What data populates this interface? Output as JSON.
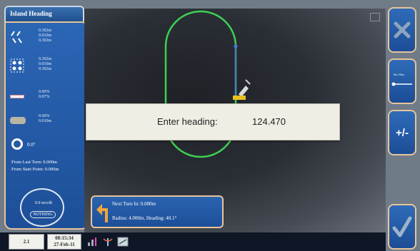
{
  "title": "Island Heading",
  "stats": [
    {
      "icon": "diagonal-lanes-icon",
      "values": [
        "0.302m",
        "0.010m",
        "0.302m"
      ]
    },
    {
      "icon": "dotted-square-icon",
      "values": [
        "0.302m",
        "0.010m",
        "0.302m"
      ]
    },
    {
      "icon": "lane-line-icon",
      "values": [
        "0.00%",
        "0.07%"
      ]
    },
    {
      "icon": "implement-icon",
      "values": [
        "0.00%",
        "0.010m"
      ]
    }
  ],
  "angle": "0.0°",
  "info": {
    "from_last_turn": "From Last Turn: 0.000m",
    "from_start_point": "From Start Point: 0.000m"
  },
  "dial": {
    "label": "0.0 m/s/dt",
    "button": "NOTHING"
  },
  "dialog": {
    "label": "Enter heading:",
    "value": "124.470"
  },
  "next_turn": {
    "line1": "Next Turn In: 0.000m",
    "line2": "Radius: 4.000m, Heading: 40.1°"
  },
  "right_buttons": {
    "close": "close",
    "scale_label": "0m 10m",
    "plus_minus": "+/-",
    "confirm": "confirm"
  },
  "status": {
    "zoom": "2.1",
    "time": "08:15:34",
    "date": "27-Feb-11"
  },
  "colors": {
    "track": "#3fcf54",
    "accent": "#e8c49a",
    "panel": "#1d4f98"
  }
}
